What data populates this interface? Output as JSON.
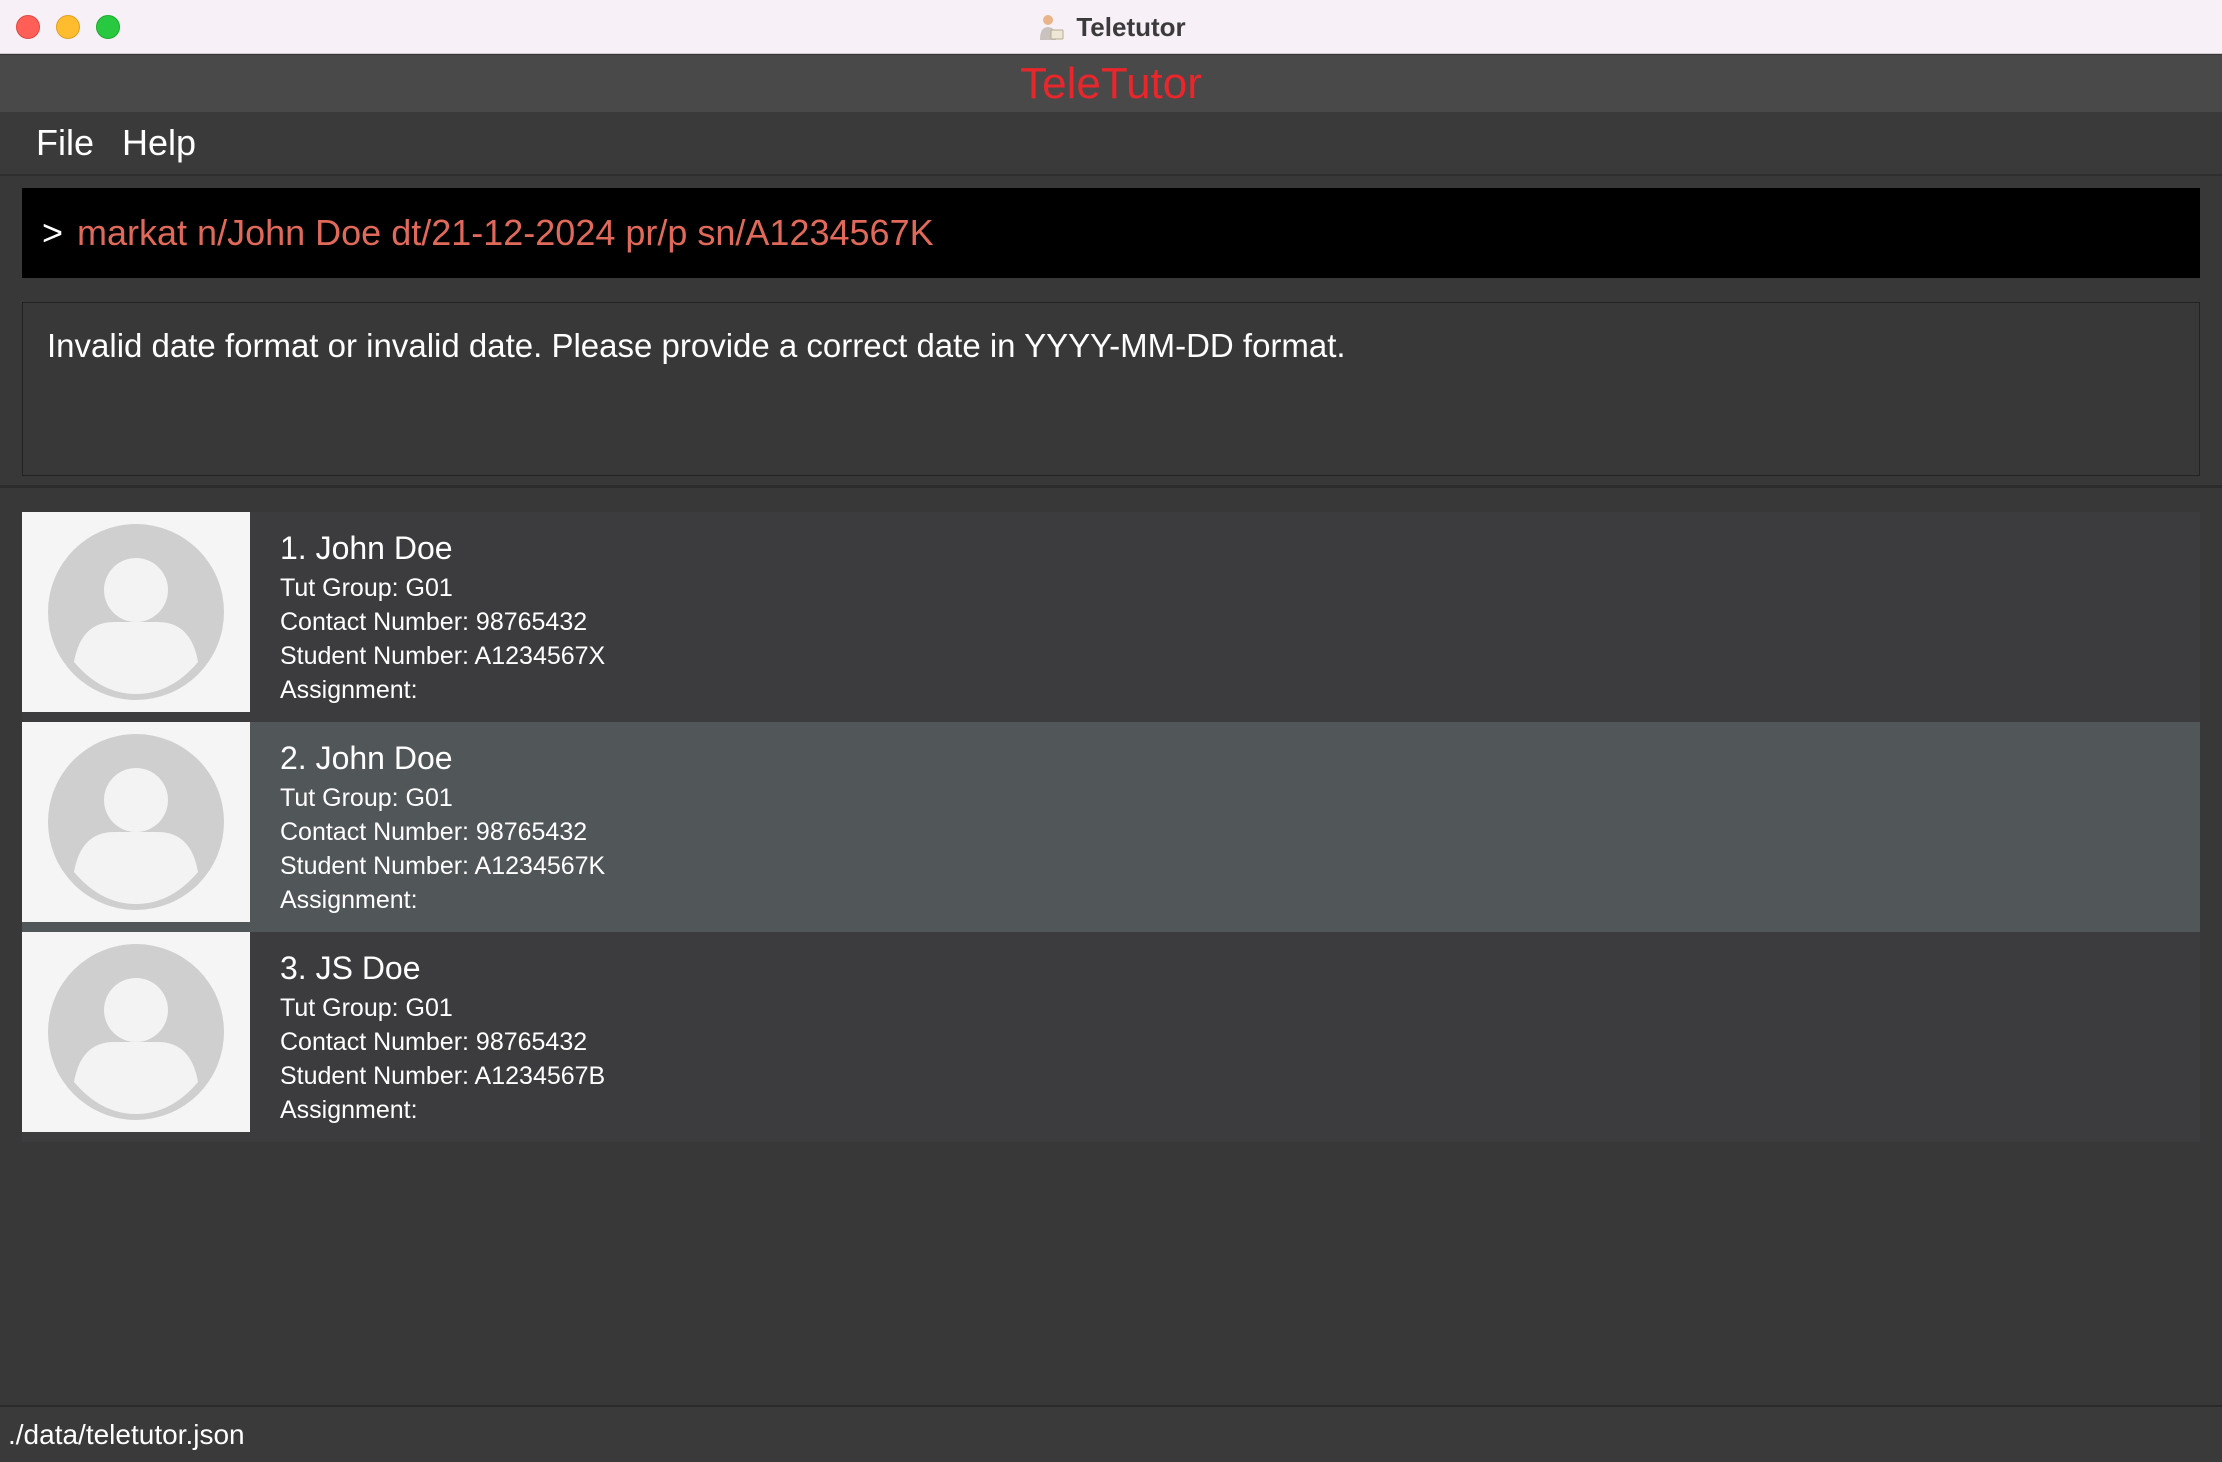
{
  "window": {
    "title": "Teletutor"
  },
  "header": {
    "app_name": "TeleTutor"
  },
  "menu": {
    "items": [
      "File",
      "Help"
    ]
  },
  "command": {
    "prompt": ">",
    "value": "markat n/John Doe dt/21-12-2024 pr/p sn/A1234567K"
  },
  "result": {
    "message": "Invalid date format or invalid date. Please provide a correct date in YYYY-MM-DD format."
  },
  "students": [
    {
      "name": "1. John Doe",
      "tut_group": "Tut Group: G01",
      "contact": "Contact Number: 98765432",
      "student_number": "Student Number: A1234567X",
      "assignment": "Assignment:"
    },
    {
      "name": "2. John Doe",
      "tut_group": "Tut Group: G01",
      "contact": "Contact Number: 98765432",
      "student_number": "Student Number: A1234567K",
      "assignment": "Assignment:"
    },
    {
      "name": "3. JS Doe",
      "tut_group": "Tut Group: G01",
      "contact": "Contact Number: 98765432",
      "student_number": "Student Number: A1234567B",
      "assignment": "Assignment:"
    }
  ],
  "status": {
    "file_path": "./data/teletutor.json"
  },
  "colors": {
    "accent": "#e8262c",
    "command_text": "#e0695a",
    "selected_row": "#515658"
  },
  "icons": {
    "app": "person-reading-icon",
    "avatar": "default-avatar-icon"
  }
}
